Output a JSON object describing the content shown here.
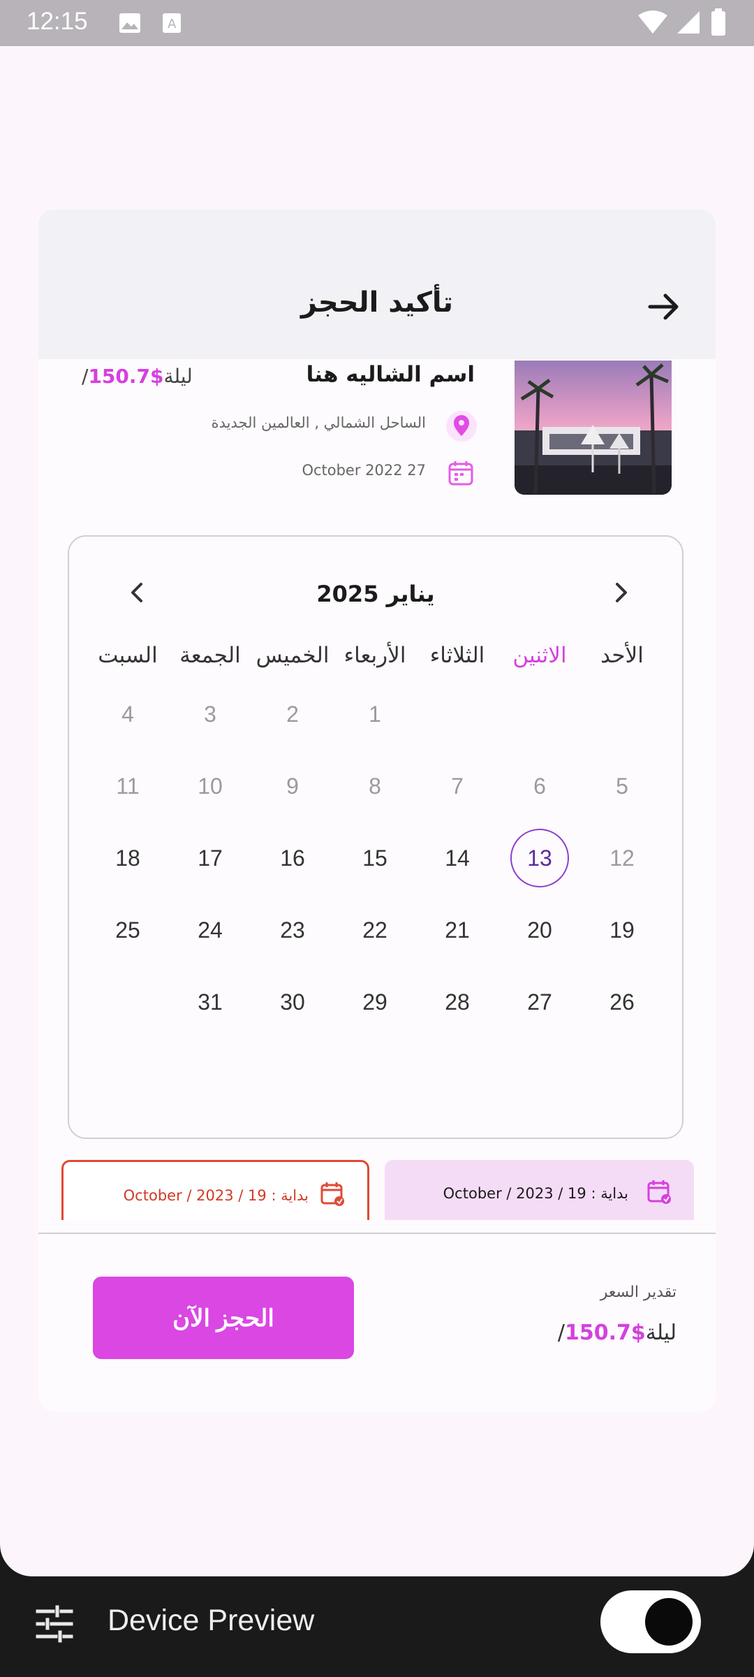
{
  "status_bar": {
    "time": "12:15"
  },
  "header": {
    "title": "تأكيد الحجز"
  },
  "chalet": {
    "name": "اسم الشاليه هنا",
    "price_amount": "$150.7",
    "price_unit": "/ليلة",
    "location": "الساحل الشمالي , العالمين الجديدة",
    "date": "October 2022 27"
  },
  "calendar": {
    "month": "يناير 2025",
    "weekdays": [
      "الأحد",
      "الاثنين",
      "الثلاثاء",
      "الأربعاء",
      "الخميس",
      "الجمعة",
      "السبت"
    ],
    "active_weekday_index": 1,
    "rows": [
      [
        "",
        "",
        "",
        "1",
        "2",
        "3",
        "4"
      ],
      [
        "5",
        "6",
        "7",
        "8",
        "9",
        "10",
        "11"
      ],
      [
        "12",
        "13",
        "14",
        "15",
        "16",
        "17",
        "18"
      ],
      [
        "19",
        "20",
        "21",
        "22",
        "23",
        "24",
        "25"
      ],
      [
        "26",
        "27",
        "28",
        "29",
        "30",
        "31",
        ""
      ]
    ],
    "selected_day": "13"
  },
  "range": {
    "start_label": "بداية : 19 / 2023 / October",
    "end_label": "بداية : 19 / 2023 / October"
  },
  "footer": {
    "book_button": "الحجز الآن",
    "estimate_label": "تقدير السعر",
    "estimate_amount": "$150.7",
    "estimate_unit": "/ليلة"
  },
  "device_preview": {
    "label": "Device Preview"
  },
  "colors": {
    "accent": "#d441de",
    "button": "#da47e3",
    "selected_ring": "#8c3fcf",
    "end_border": "#e04a35"
  }
}
